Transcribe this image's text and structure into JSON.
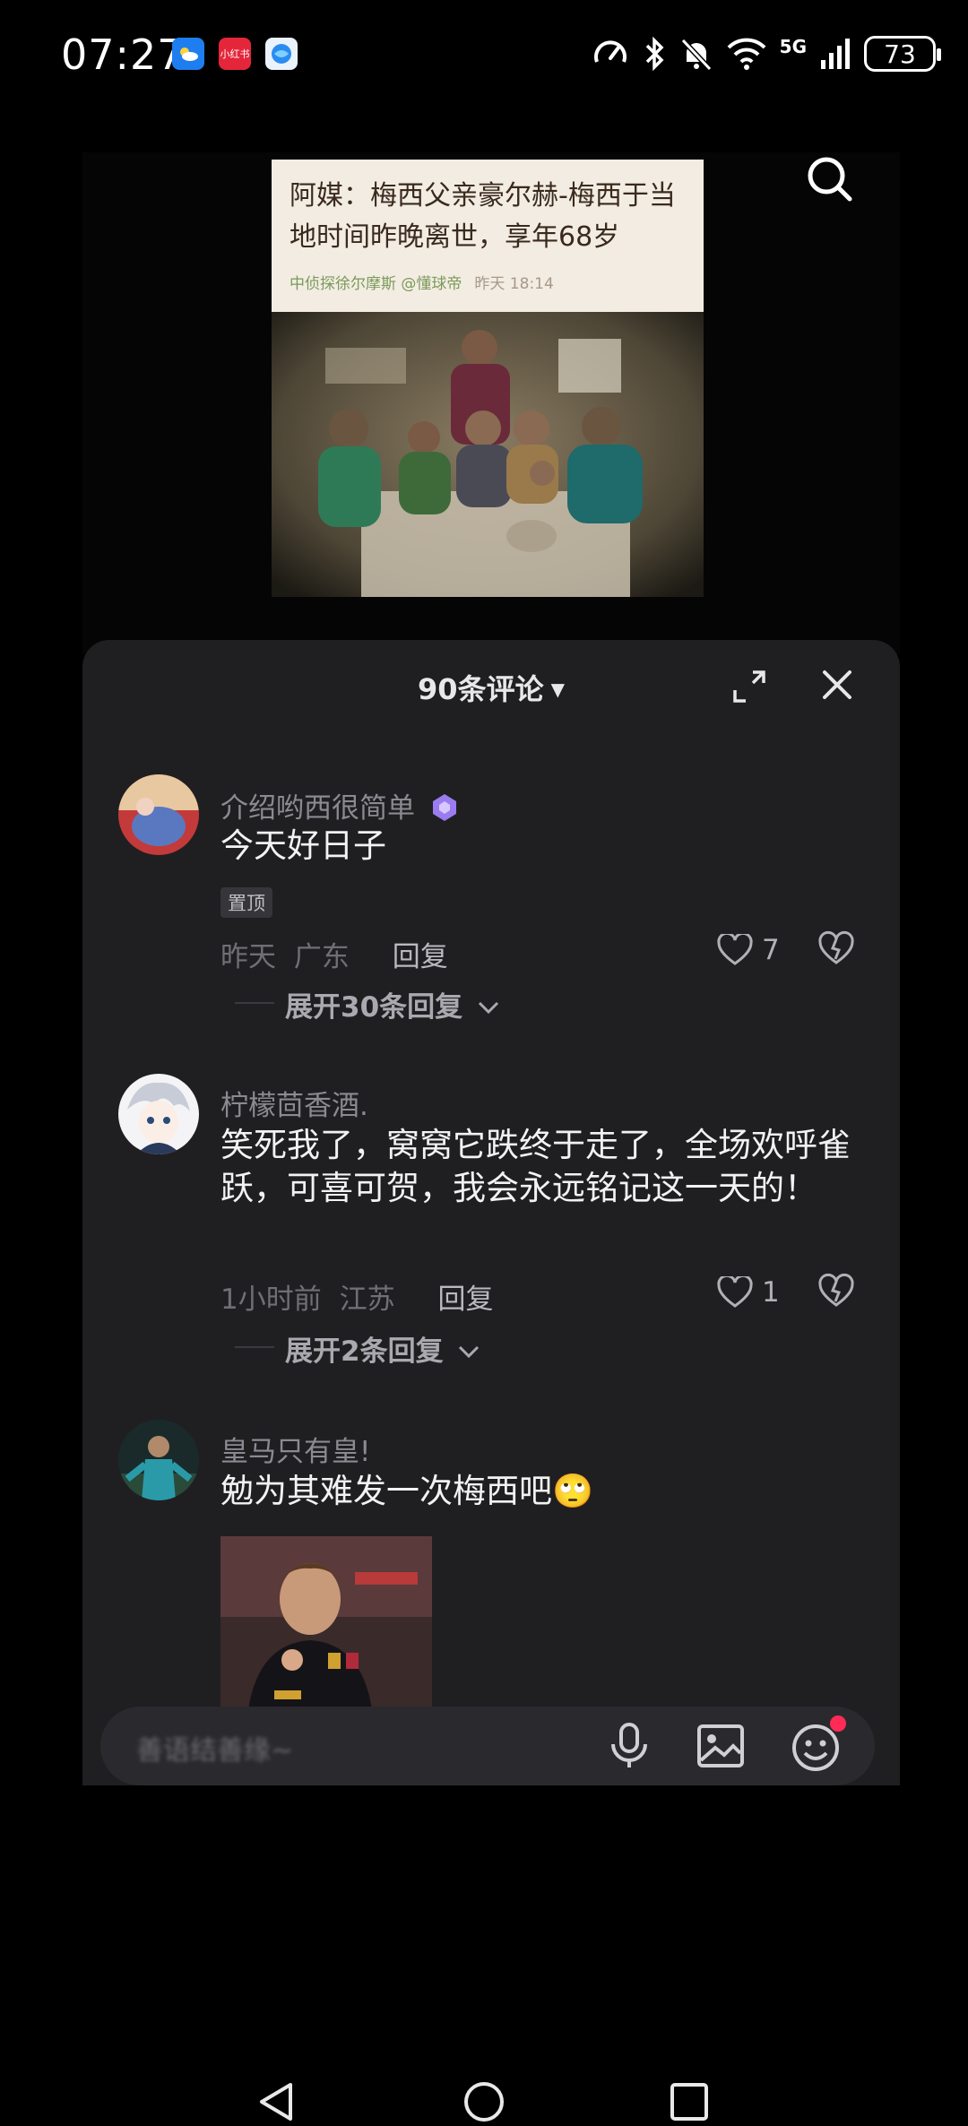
{
  "status_bar": {
    "time": "07:27",
    "badges": [
      "weather-app-icon",
      "xiaohongshu-app-icon",
      "browser-app-icon"
    ],
    "xhs_label": "小红书",
    "network": "5G",
    "battery": "73"
  },
  "video": {
    "headline": "阿媒：梅西父亲豪尔赫-梅西于当地时间昨晚离世，享年68岁",
    "author": "中侦探徐尔摩斯 @懂球帝",
    "time": "昨天 18:14"
  },
  "panel": {
    "title": "90条评论",
    "comments": [
      {
        "username": "介绍哟西很简单",
        "text": "今天好日子",
        "tag": "置顶",
        "time": "昨天",
        "location": "广东",
        "reply_label": "回复",
        "likes": "7",
        "expand_label": "展开30条回复"
      },
      {
        "username": "柠檬茴香酒.",
        "text": "笑死我了，窝窝它跌终于走了，全场欢呼雀跃，可喜可贺，我会永远铭记这一天的！",
        "time": "1小时前",
        "location": "江苏",
        "reply_label": "回复",
        "likes": "1",
        "expand_label": "展开2条回复"
      },
      {
        "username": "皇马只有皇!",
        "text": "勉为其难发一次梅西吧",
        "emoji": "🙄"
      }
    ]
  },
  "input": {
    "placeholder": "善语结善缘~"
  },
  "colors": {
    "panel_bg": "#1f1f22",
    "accent_badge": "#9a7cf0",
    "notification_dot": "#ff2a55"
  }
}
